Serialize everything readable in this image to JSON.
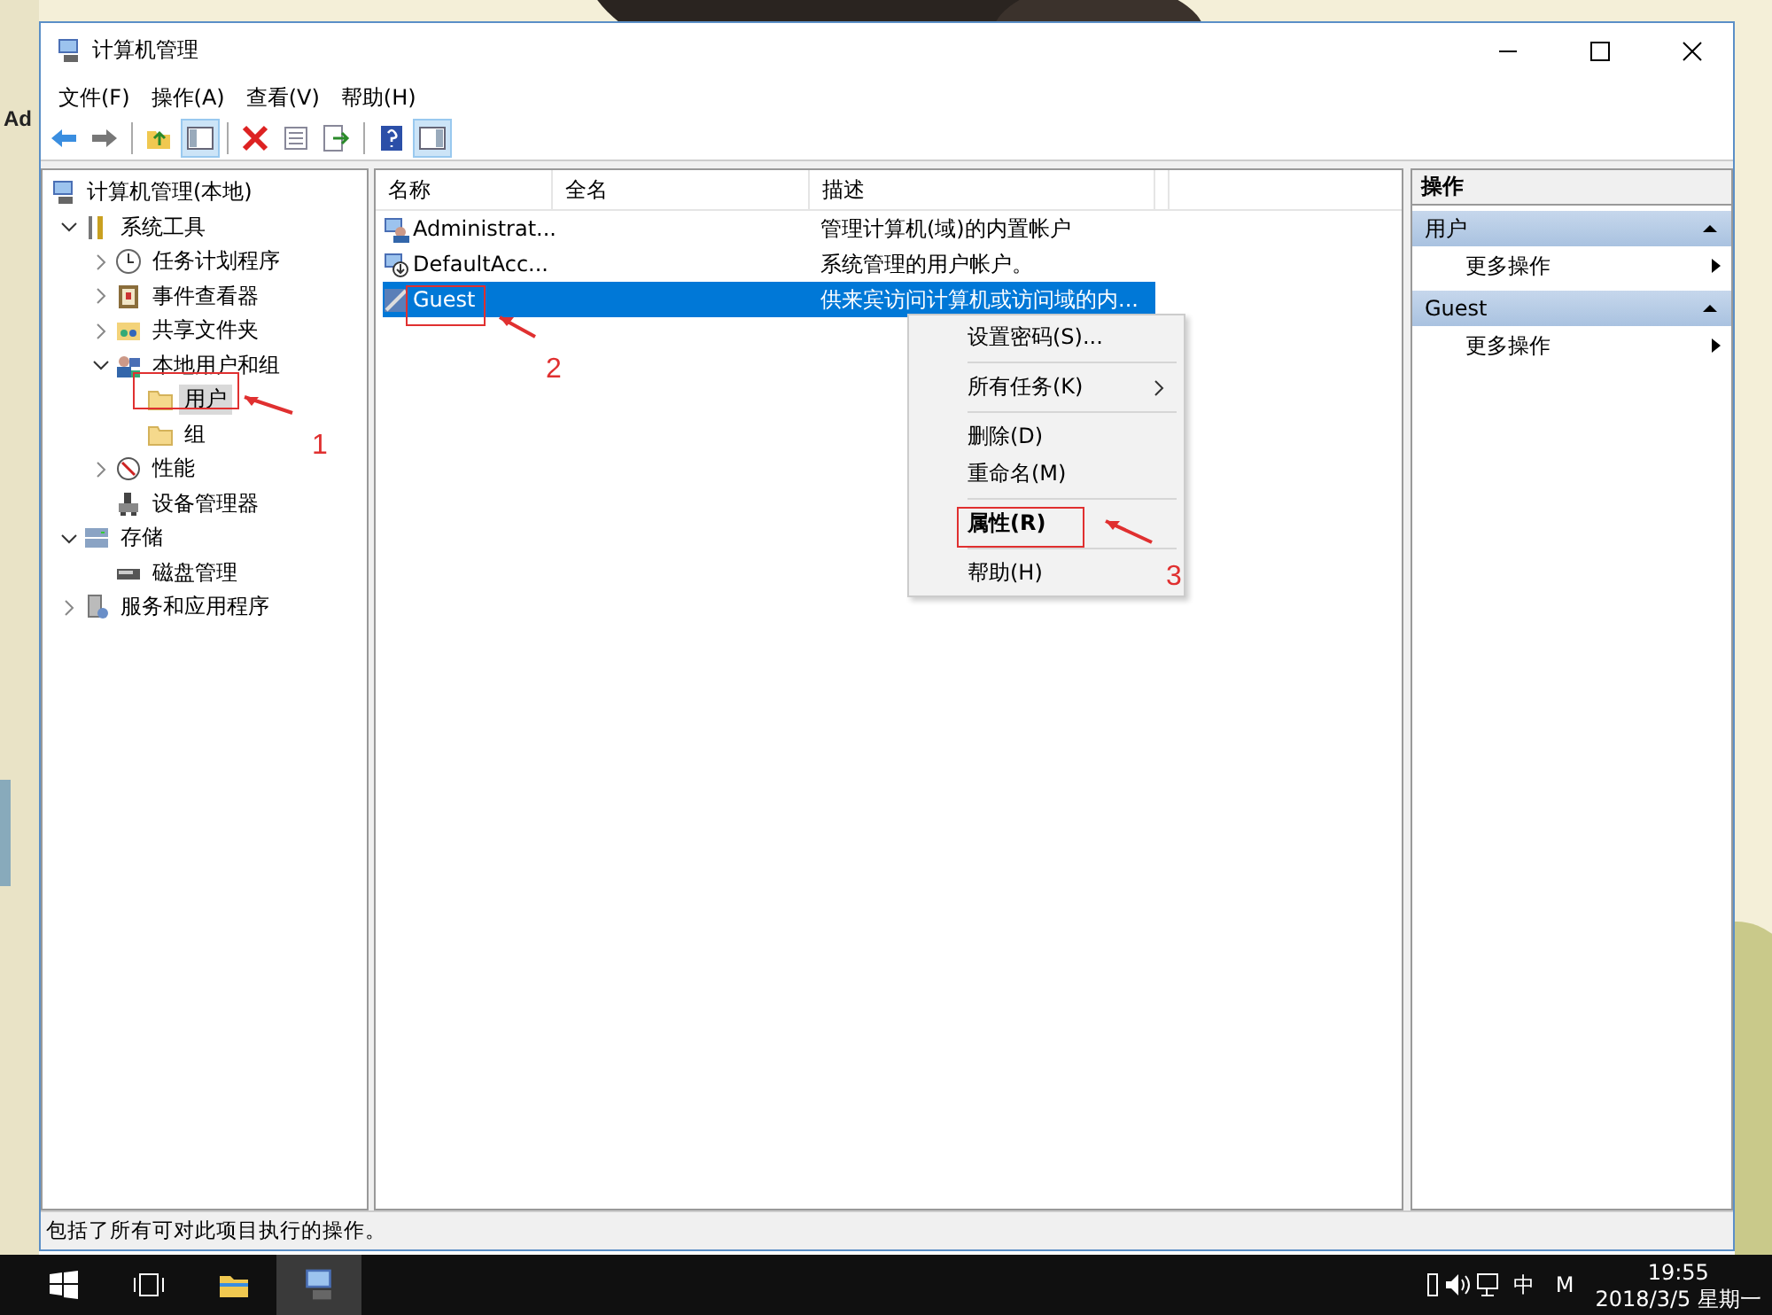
{
  "desktop": {
    "icon_label": "Ad"
  },
  "window": {
    "title": "计算机管理",
    "menu": [
      "文件(F)",
      "操作(A)",
      "查看(V)",
      "帮助(H)"
    ]
  },
  "toolbar": [
    {
      "kind": "back",
      "pressed": false
    },
    {
      "kind": "forward",
      "pressed": false
    },
    {
      "kind": "separator"
    },
    {
      "kind": "up",
      "pressed": false
    },
    {
      "kind": "tree-toggle",
      "pressed": true
    },
    {
      "kind": "separator"
    },
    {
      "kind": "delete",
      "pressed": false
    },
    {
      "kind": "properties",
      "pressed": false
    },
    {
      "kind": "export",
      "pressed": false
    },
    {
      "kind": "separator"
    },
    {
      "kind": "help",
      "pressed": false
    },
    {
      "kind": "action-toggle",
      "pressed": true
    }
  ],
  "tree": [
    {
      "label": "计算机管理(本地)",
      "selected": false,
      "children": [
        {
          "label": "系统工具",
          "expanded": true,
          "selected": false,
          "children": [
            {
              "label": "任务计划程序",
              "expanded": false,
              "selected": false
            },
            {
              "label": "事件查看器",
              "expanded": false,
              "selected": false
            },
            {
              "label": "共享文件夹",
              "expanded": false,
              "selected": false
            },
            {
              "label": "本地用户和组",
              "expanded": true,
              "selected": false,
              "children": [
                {
                  "label": "用户",
                  "selected": true
                },
                {
                  "label": "组",
                  "selected": false
                }
              ]
            },
            {
              "label": "性能",
              "expanded": false,
              "selected": false
            },
            {
              "label": "设备管理器",
              "selected": false
            }
          ]
        },
        {
          "label": "存储",
          "expanded": true,
          "selected": false,
          "children": [
            {
              "label": "磁盘管理",
              "selected": false
            }
          ]
        },
        {
          "label": "服务和应用程序",
          "expanded": false,
          "selected": false
        }
      ]
    }
  ],
  "list": {
    "columns": [
      "名称",
      "全名",
      "描述"
    ],
    "rows": [
      {
        "name": "Administrat...",
        "description": "管理计算机(域)的内置帐户",
        "selected": false
      },
      {
        "name": "DefaultAcc...",
        "description": "系统管理的用户帐户。",
        "selected": false
      },
      {
        "name": "Guest",
        "description": "供来宾访问计算机或访问域的内...",
        "selected": true
      }
    ]
  },
  "context_menu": [
    {
      "kind": "item",
      "label": "设置密码(S)...",
      "default": false
    },
    {
      "kind": "separator"
    },
    {
      "kind": "submenu",
      "label": "所有任务(K)",
      "default": false
    },
    {
      "kind": "separator"
    },
    {
      "kind": "item",
      "label": "删除(D)",
      "default": false
    },
    {
      "kind": "item",
      "label": "重命名(M)",
      "default": false
    },
    {
      "kind": "separator"
    },
    {
      "kind": "item",
      "label": "属性(R)",
      "default": true
    },
    {
      "kind": "separator"
    },
    {
      "kind": "item",
      "label": "帮助(H)",
      "default": false
    }
  ],
  "actions": {
    "title": "操作",
    "groups": [
      {
        "title": "用户",
        "expanded": true,
        "items": [
          "更多操作"
        ]
      },
      {
        "title": "Guest",
        "expanded": true,
        "items": [
          "更多操作"
        ]
      }
    ]
  },
  "status_bar": "包括了所有可对此项目执行的操作。",
  "annotations": [
    {
      "label": "1"
    },
    {
      "label": "2"
    },
    {
      "label": "3"
    }
  ],
  "taskbar": {
    "tray": [
      "中",
      "M"
    ],
    "time": "19:55",
    "date": "2018/3/5 星期一"
  }
}
